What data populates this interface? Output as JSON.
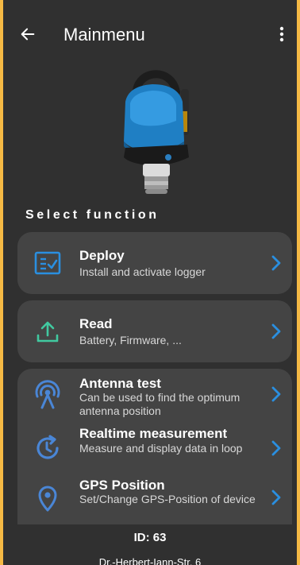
{
  "colors": {
    "app_background": "#303030",
    "card_background": "#444444",
    "accent_blue": "#2a8fe0",
    "accent_green": "#41c9a0",
    "frame": "#f5b944"
  },
  "header": {
    "title": "Mainmenu",
    "back_icon": "arrow-left-icon",
    "menu_icon": "more-vertical-icon"
  },
  "section": {
    "title": "Select function"
  },
  "functions": [
    {
      "title": "Deploy",
      "subtitle": "Install and activate logger",
      "icon": "checklist-icon"
    },
    {
      "title": "Read",
      "subtitle": "Battery, Firmware, ...",
      "icon": "upload-icon"
    },
    {
      "title": "Antenna test",
      "subtitle": "Can be used to find the optimum antenna position",
      "icon": "antenna-icon"
    },
    {
      "title": "Realtime measurement",
      "subtitle": "Measure and display data in loop",
      "icon": "clock-refresh-icon"
    },
    {
      "title": "GPS Position",
      "subtitle": "Set/Change GPS-Position of device",
      "icon": "location-pin-icon"
    }
  ],
  "footer": {
    "id_label": "ID: 63",
    "address": "Dr.-Herbert-Iann-Str. 6"
  }
}
